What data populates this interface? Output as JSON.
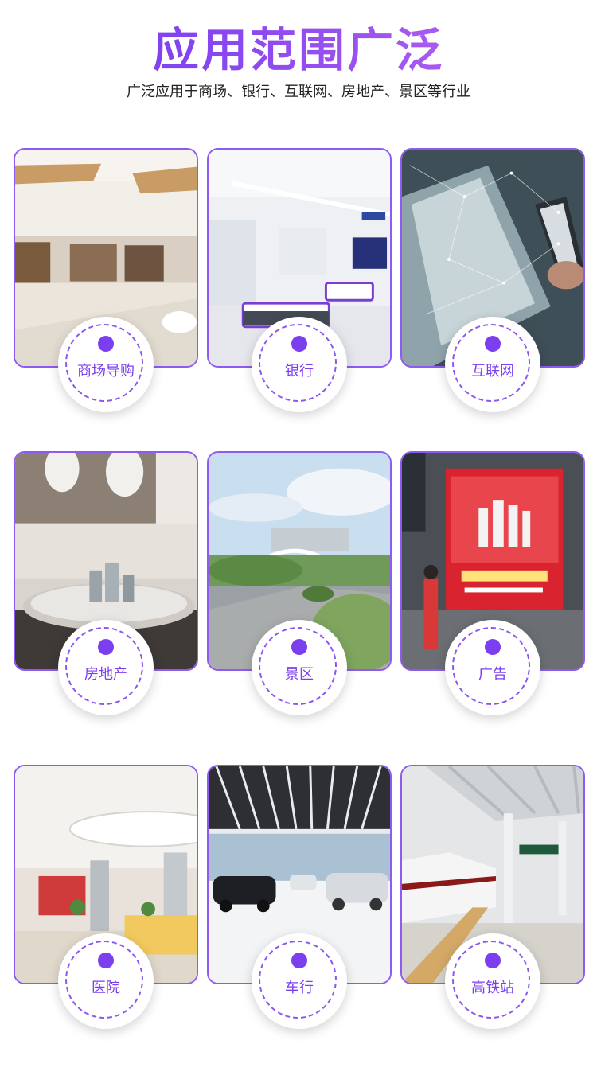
{
  "header": {
    "title": "应用范围广泛",
    "subtitle": "广泛应用于商场、银行、互联网、房地产、景区等行业"
  },
  "colors": {
    "accent": "#7b3ff0",
    "border": "#8f5af2"
  },
  "cards": [
    {
      "label": "商场导购",
      "icon": "mall-interior-photo"
    },
    {
      "label": "银行",
      "icon": "bank-lobby-photo"
    },
    {
      "label": "互联网",
      "icon": "network-phone-laptop-photo"
    },
    {
      "label": "房地产",
      "icon": "real-estate-sales-office-photo"
    },
    {
      "label": "景区",
      "icon": "scenic-park-photo"
    },
    {
      "label": "广告",
      "icon": "advertising-lightbox-photo"
    },
    {
      "label": "医院",
      "icon": "hospital-lobby-photo"
    },
    {
      "label": "车行",
      "icon": "car-showroom-photo"
    },
    {
      "label": "高铁站",
      "icon": "railway-station-photo"
    }
  ]
}
